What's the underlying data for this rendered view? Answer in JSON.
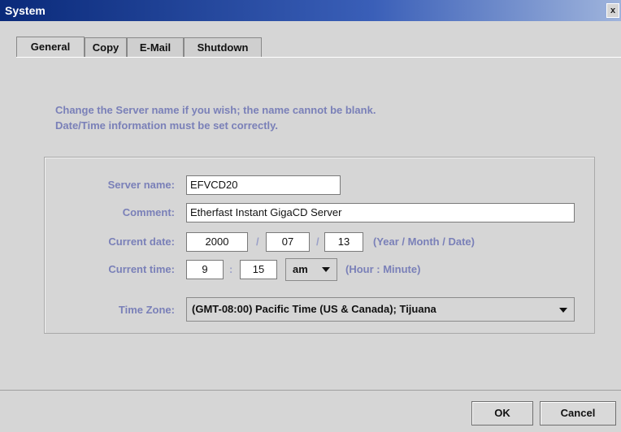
{
  "window": {
    "title": "System",
    "close_label": "x"
  },
  "tabs": [
    {
      "label": "General",
      "active": true
    },
    {
      "label": "Copy",
      "active": false
    },
    {
      "label": "E-Mail",
      "active": false
    },
    {
      "label": "Shutdown",
      "active": false
    }
  ],
  "info": {
    "line1": "Change the Server name if you wish; the name cannot be blank.",
    "line2": "Date/Time information must be set correctly."
  },
  "form": {
    "server_name_label": "Server name:",
    "server_name_value": "EFVCD20",
    "comment_label": "Comment:",
    "comment_value": "Etherfast Instant GigaCD Server",
    "date_label": "Current date:",
    "date_year": "2000",
    "date_month": "07",
    "date_day": "13",
    "date_sep": "/",
    "date_hint": "(Year / Month / Date)",
    "time_label": "Current time:",
    "time_hour": "9",
    "time_minute": "15",
    "time_sep": ":",
    "time_ampm": "am",
    "time_hint": "(Hour : Minute)",
    "tz_label": "Time Zone:",
    "tz_value": "(GMT-08:00) Pacific Time (US & Canada); Tijuana"
  },
  "buttons": {
    "ok": "OK",
    "cancel": "Cancel"
  },
  "colors": {
    "label": "#7a80b8",
    "title_start": "#0a2a7a"
  }
}
